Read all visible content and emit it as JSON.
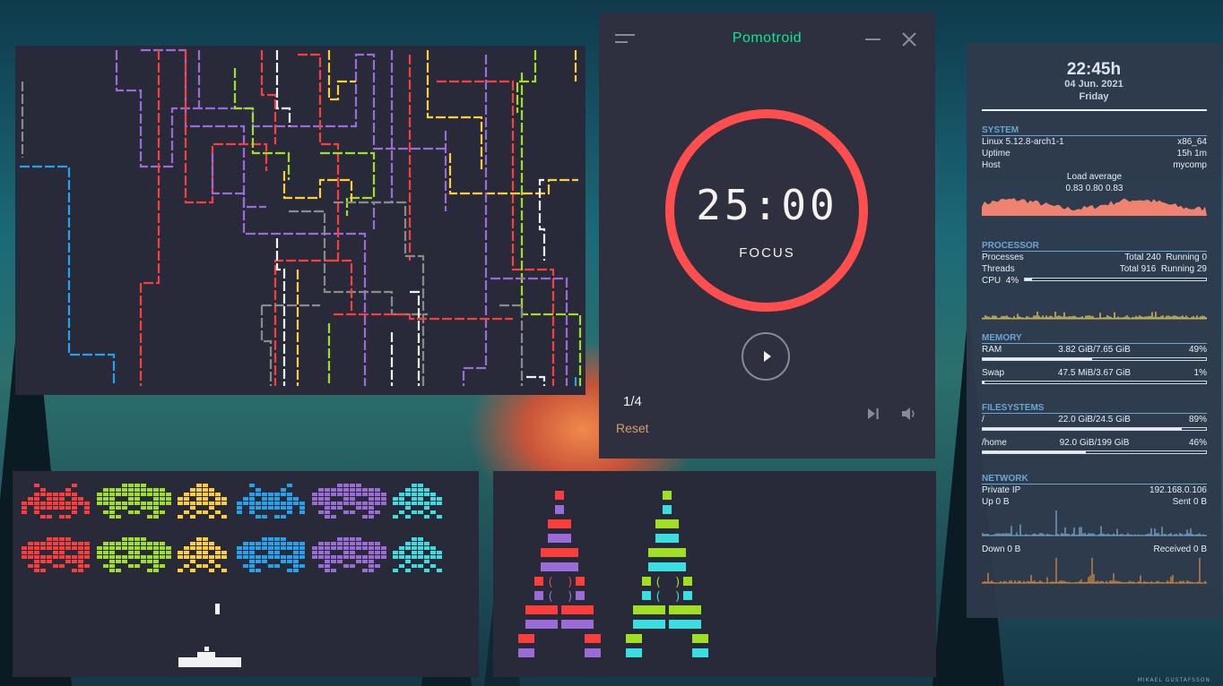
{
  "colors": {
    "red": "#fa3e3c",
    "green": "#9fe025",
    "yellow": "#ffcd36",
    "blue": "#21a4ed",
    "purple": "#9b6cd6",
    "cyan": "#3bdfe2",
    "white": "#f2f2f2",
    "gray": "#8a8a8a",
    "pomo_ring": "#ff4e4d",
    "pomo_title": "#05ec8c",
    "panel_bg": "#282a3a"
  },
  "pomotroid": {
    "title": "Pomotroid",
    "time": "25:00",
    "mode": "FOCUS",
    "round": "1/4",
    "reset_label": "Reset",
    "progress": 1.0,
    "icons": [
      "menu-icon",
      "minimize-icon",
      "close-icon",
      "play-icon",
      "skip-icon",
      "volume-icon"
    ]
  },
  "conky": {
    "clock": "22:45h",
    "date": "04 Jun. 2021",
    "day": "Friday",
    "system": {
      "header": "SYSTEM",
      "kernel": "Linux 5.12.8-arch1-1",
      "arch": "x86_64",
      "uptime_label": "Uptime",
      "uptime": "15h 1m",
      "host_label": "Host",
      "host": "mycomp",
      "load_label": "Load average",
      "load": "0.83 0.80 0.83"
    },
    "processor": {
      "header": "PROCESSOR",
      "processes_label": "Processes",
      "processes": "Total 240  Running 0",
      "threads_label": "Threads",
      "threads": "Total 916  Running 29",
      "cpu_label": "CPU",
      "cpu_pct": "4%",
      "cpu_value": 0.04
    },
    "memory": {
      "header": "MEMORY",
      "ram_label": "RAM",
      "ram": "3.82 GiB/7.65 GiB",
      "ram_pct": "49%",
      "ram_value": 0.49,
      "swap_label": "Swap",
      "swap": "47.5 MiB/3.67 GiB",
      "swap_pct": "1%",
      "swap_value": 0.01
    },
    "filesystems": {
      "header": "FILESYSTEMS",
      "root_label": "/",
      "root": "22.0 GiB/24.5 GiB",
      "root_pct": "89%",
      "root_value": 0.89,
      "home_label": "/home",
      "home": "92.0 GiB/199 GiB",
      "home_pct": "46%",
      "home_value": 0.46
    },
    "network": {
      "header": "NETWORK",
      "ip_label": "Private IP",
      "ip": "192.168.0.106",
      "up_label": "Up 0 B",
      "sent_label": "Sent 0 B",
      "down_label": "Down 0 B",
      "received_label": "Received 0 B"
    }
  },
  "wallpaper_credit": "MIKAEL GUSTAFSSON"
}
